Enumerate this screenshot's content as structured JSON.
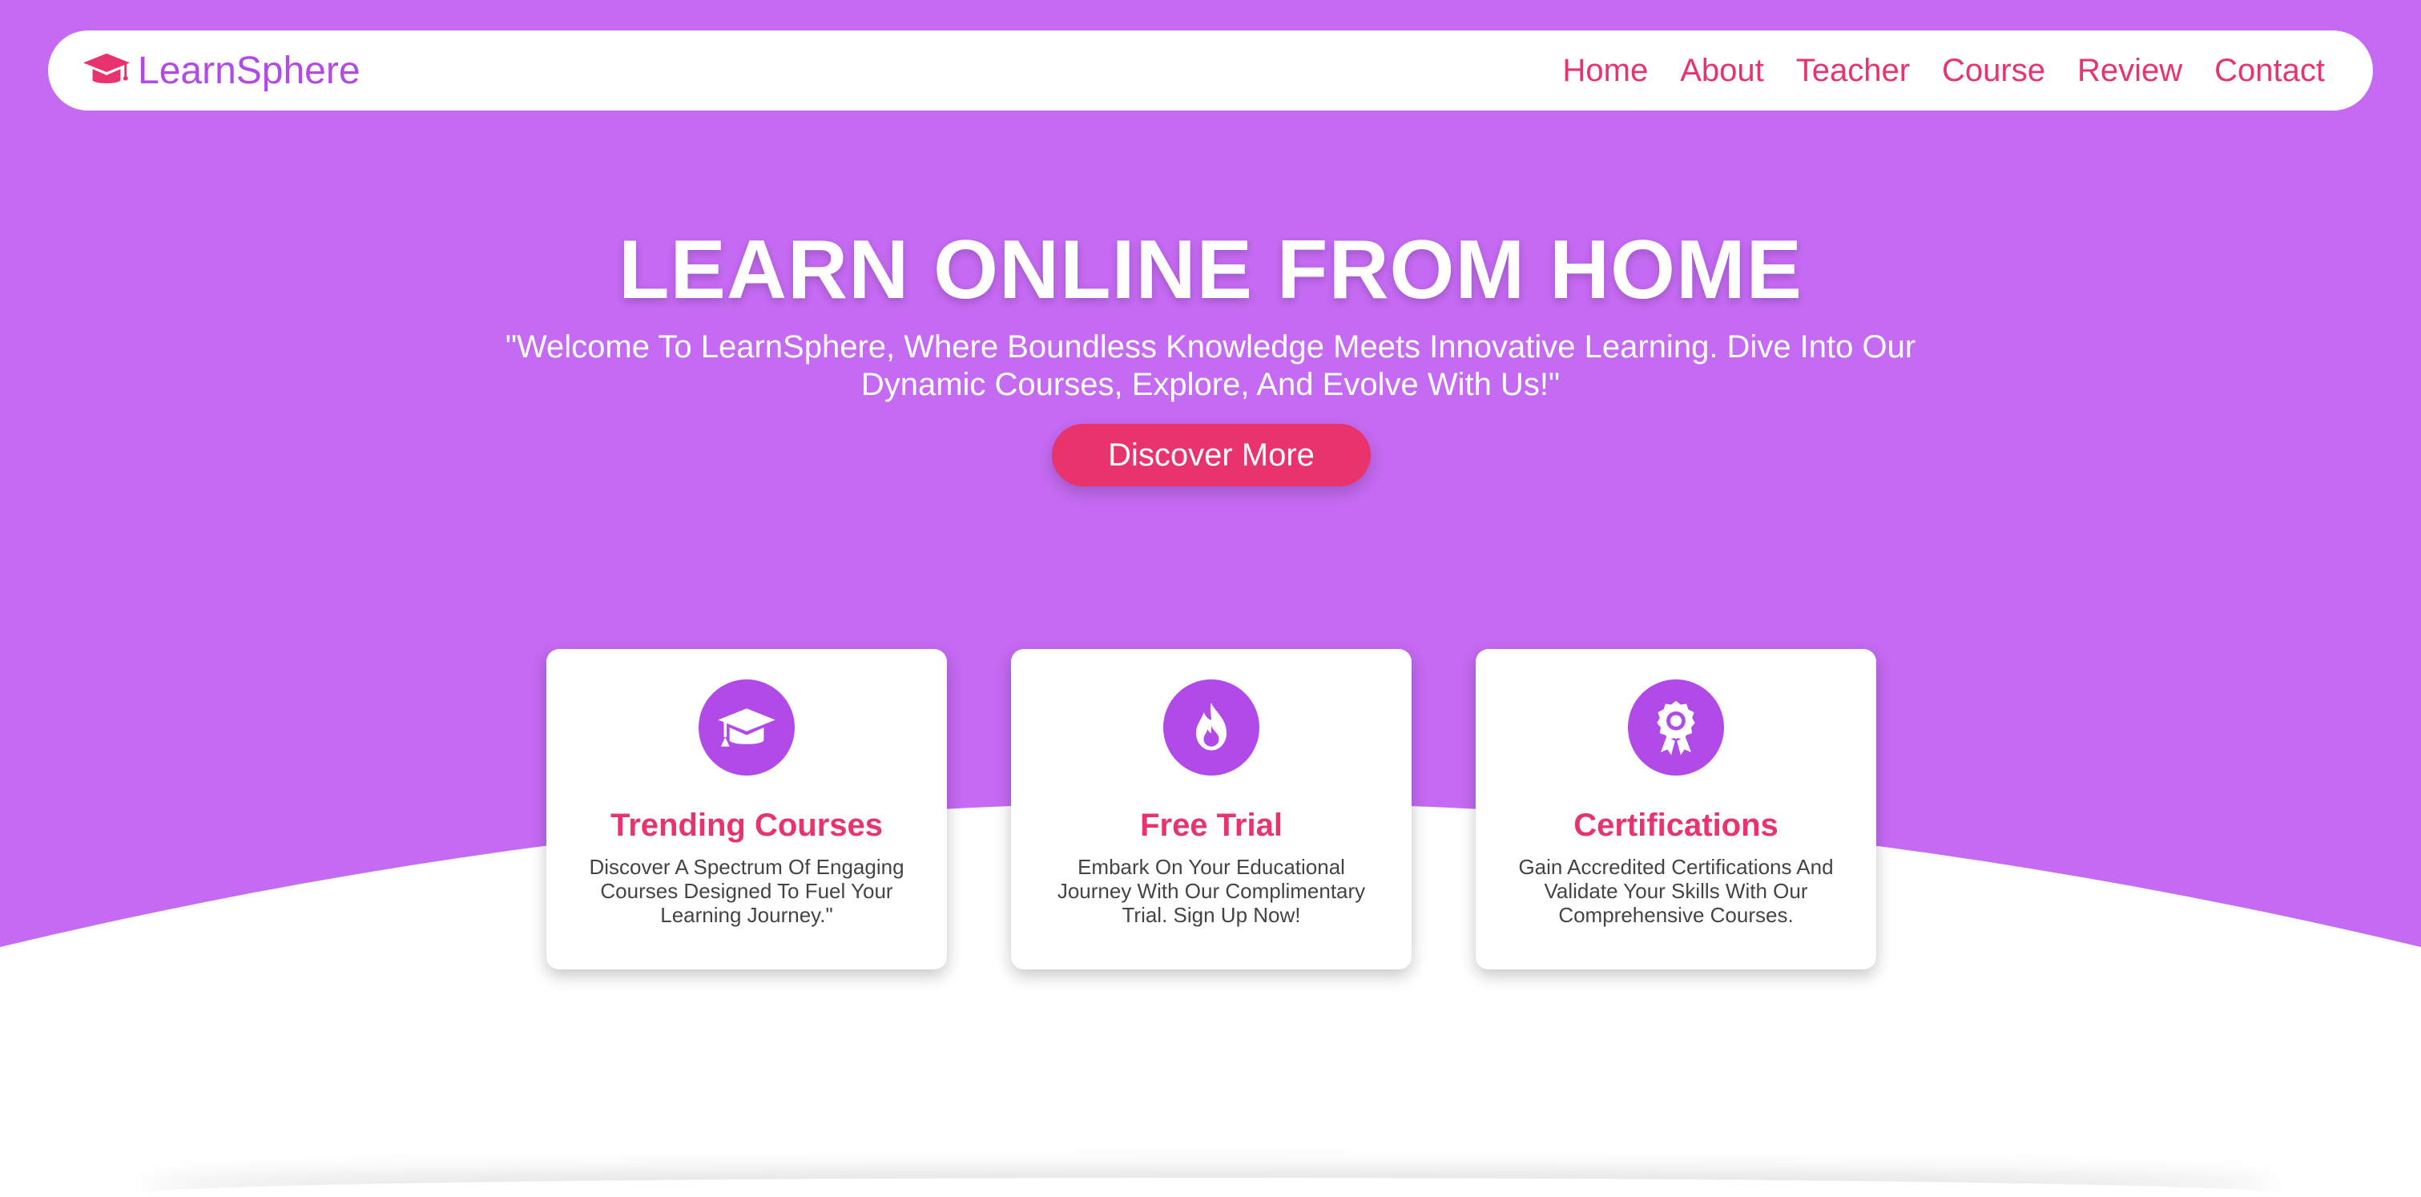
{
  "colors": {
    "hero_bg": "#c56af2",
    "brand_purple": "#b14ae6",
    "accent_pink": "#e8336c",
    "white": "#ffffff"
  },
  "nav": {
    "logo_icon": "graduation-cap-icon",
    "logo_text": "LearnSphere",
    "links": [
      "Home",
      "About",
      "Teacher",
      "Course",
      "Review",
      "Contact"
    ]
  },
  "hero": {
    "title": "LEARN ONLINE FROM HOME",
    "subtitle": "\"Welcome To LearnSphere, Where Boundless Knowledge Meets Innovative Learning. Dive Into Our Dynamic Courses, Explore, And Evolve With Us!\"",
    "cta_label": "Discover More"
  },
  "features": [
    {
      "icon": "graduation-cap-icon",
      "title": "Trending Courses",
      "text": "Discover A Spectrum Of Engaging Courses Designed To Fuel Your Learning Journey.\""
    },
    {
      "icon": "fire-icon",
      "title": "Free Trial",
      "text": "Embark On Your Educational Journey With Our Complimentary Trial. Sign Up Now!"
    },
    {
      "icon": "award-icon",
      "title": "Certifications",
      "text": "Gain Accredited Certifications And Validate Your Skills With Our Comprehensive Courses."
    }
  ]
}
